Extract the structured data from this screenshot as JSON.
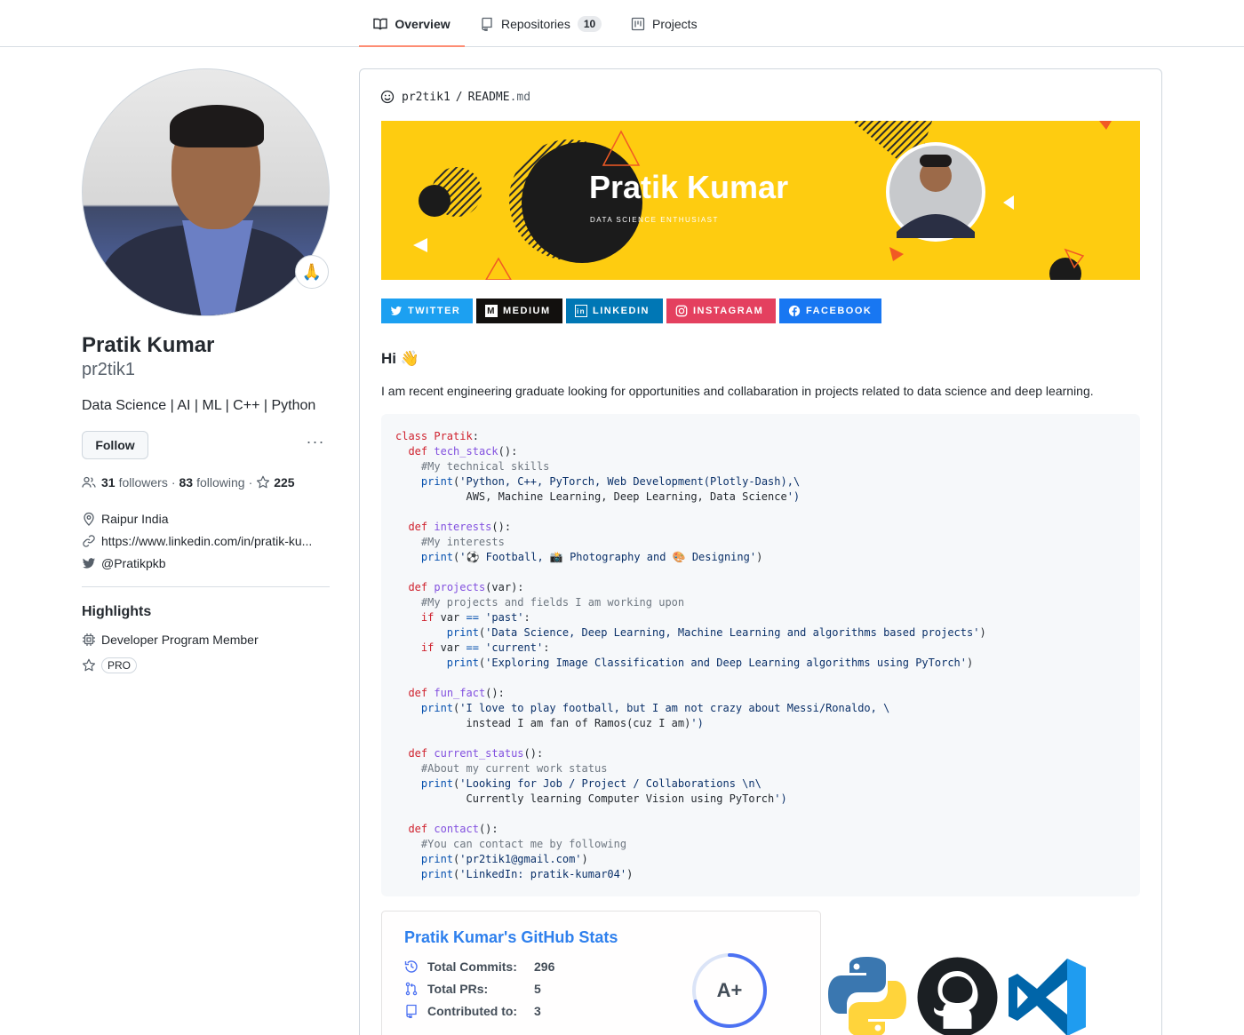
{
  "nav": {
    "tabs": [
      {
        "label": "Overview"
      },
      {
        "label": "Repositories",
        "count": "10"
      },
      {
        "label": "Projects"
      }
    ]
  },
  "profile": {
    "status_emoji": "🙏",
    "name": "Pratik Kumar",
    "login": "pr2tik1",
    "bio": "Data Science | AI | ML | C++ | Python",
    "follow_label": "Follow",
    "more_label": "···",
    "followers": "31",
    "followers_label": "followers",
    "following": "83",
    "following_label": "following",
    "stars": "225",
    "location": "Raipur India",
    "website": "https://www.linkedin.com/in/pratik-ku...",
    "twitter": "@Pratikpkb"
  },
  "highlights": {
    "title": "Highlights",
    "items": [
      "Developer Program Member"
    ],
    "pro": "PRO"
  },
  "readme": {
    "owner": "pr2tik1",
    "sep": "/",
    "file": "README",
    "ext": ".md",
    "banner_title": "Pratik Kumar",
    "banner_subtitle": "DATA SCIENCE ENTHUSIAST",
    "badges": [
      {
        "label": "TWITTER",
        "color": "#1ca0f1"
      },
      {
        "label": "MEDIUM",
        "color": "#12100e"
      },
      {
        "label": "LINKEDIN",
        "color": "#0077b5"
      },
      {
        "label": "INSTAGRAM",
        "color": "#e4405f"
      },
      {
        "label": "FACEBOOK",
        "color": "#1877f2"
      }
    ],
    "greeting": "Hi 👋",
    "intro": "I am recent engineering graduate looking for opportunities and collabaration in projects related to data science and deep learning."
  },
  "code": [
    "class Pratik:",
    "  def tech_stack():",
    "    #My technical skills",
    "    print('Python, C++, PyTorch, Web Development(Plotly-Dash),\\",
    "           AWS, Machine Learning, Deep Learning, Data Science')",
    "",
    "  def interests():",
    "    #My interests",
    "    print('⚽ Football, 📸 Photography and 🎨 Designing')",
    "",
    "  def projects(var):",
    "    #My projects and fields I am working upon",
    "    if var == 'past':",
    "        print('Data Science, Deep Learning, Machine Learning and algorithms based projects')",
    "    if var == 'current':",
    "        print('Exploring Image Classification and Deep Learning algorithms using PyTorch')",
    "",
    "  def fun_fact():",
    "    print('I love to play football, but I am not crazy about Messi/Ronaldo, \\",
    "           instead I am fan of Ramos(cuz I am)')",
    "",
    "  def current_status():",
    "    #About my current work status",
    "    print('Looking for Job / Project / Collaborations \\n\\",
    "           Currently learning Computer Vision using PyTorch')",
    "",
    "  def contact():",
    "    #You can contact me by following",
    "    print('pr2tik1@gmail.com')",
    "    print('LinkedIn: pratik-kumar04')"
  ],
  "stats": {
    "title": "Pratik Kumar's GitHub Stats",
    "rows": [
      {
        "label": "Total Commits:",
        "value": "296"
      },
      {
        "label": "Total PRs:",
        "value": "5"
      },
      {
        "label": "Contributed to:",
        "value": "3"
      }
    ],
    "grade": "A+",
    "grade_progress": 0.7
  },
  "tech_icons": [
    "python-icon",
    "github-icon",
    "vscode-icon"
  ]
}
